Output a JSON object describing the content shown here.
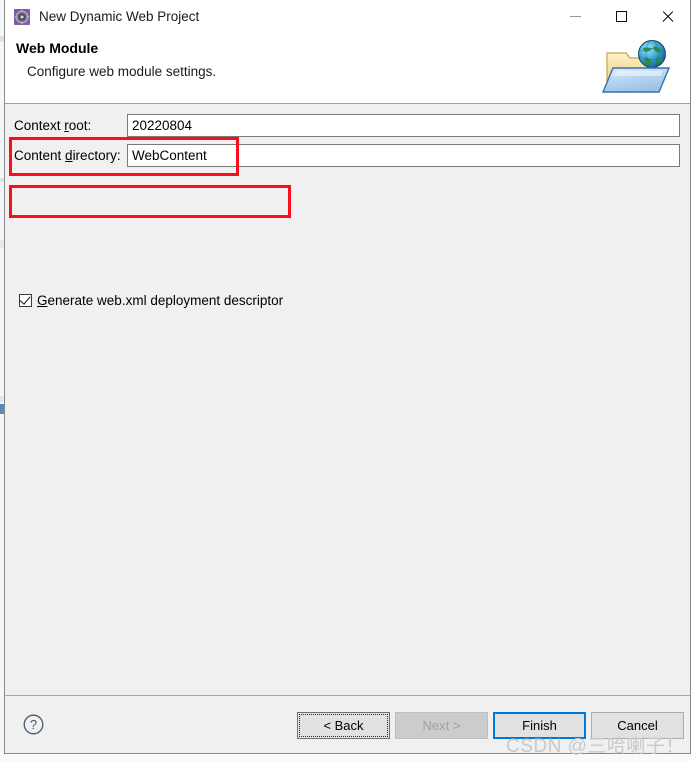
{
  "window": {
    "title": "New Dynamic Web Project",
    "icon": "wizard-gear-icon",
    "controls": {
      "minimize": "Minimize",
      "maximize": "Maximize",
      "close": "Close"
    }
  },
  "header": {
    "title": "Web Module",
    "description": "Configure web module settings.",
    "icon": "web-folder-globe-icon"
  },
  "form": {
    "context_root": {
      "label_prefix": "Context ",
      "label_mnemonic": "r",
      "label_suffix": "oot:",
      "value": "20220804"
    },
    "content_directory": {
      "label_prefix": "Content ",
      "label_mnemonic": "d",
      "label_suffix": "irectory:",
      "value": "WebContent"
    },
    "generate_webxml": {
      "label_prefix": "",
      "label_mnemonic": "G",
      "label_suffix": "enerate web.xml deployment descriptor",
      "checked": true
    }
  },
  "footer": {
    "help": "?",
    "buttons": [
      {
        "name": "back",
        "label": "< Back",
        "state": "focused"
      },
      {
        "name": "next",
        "label": "Next >",
        "state": "disabled"
      },
      {
        "name": "finish",
        "label": "Finish",
        "state": "default"
      },
      {
        "name": "cancel",
        "label": "Cancel",
        "state": "normal"
      }
    ]
  },
  "watermark": "CSDN @三哈喇子！",
  "colors": {
    "annotation": "#fc0d1b",
    "default_button_border": "#0078d7",
    "dialog_background": "#f0f0f0",
    "field_background": "#ffffff"
  }
}
